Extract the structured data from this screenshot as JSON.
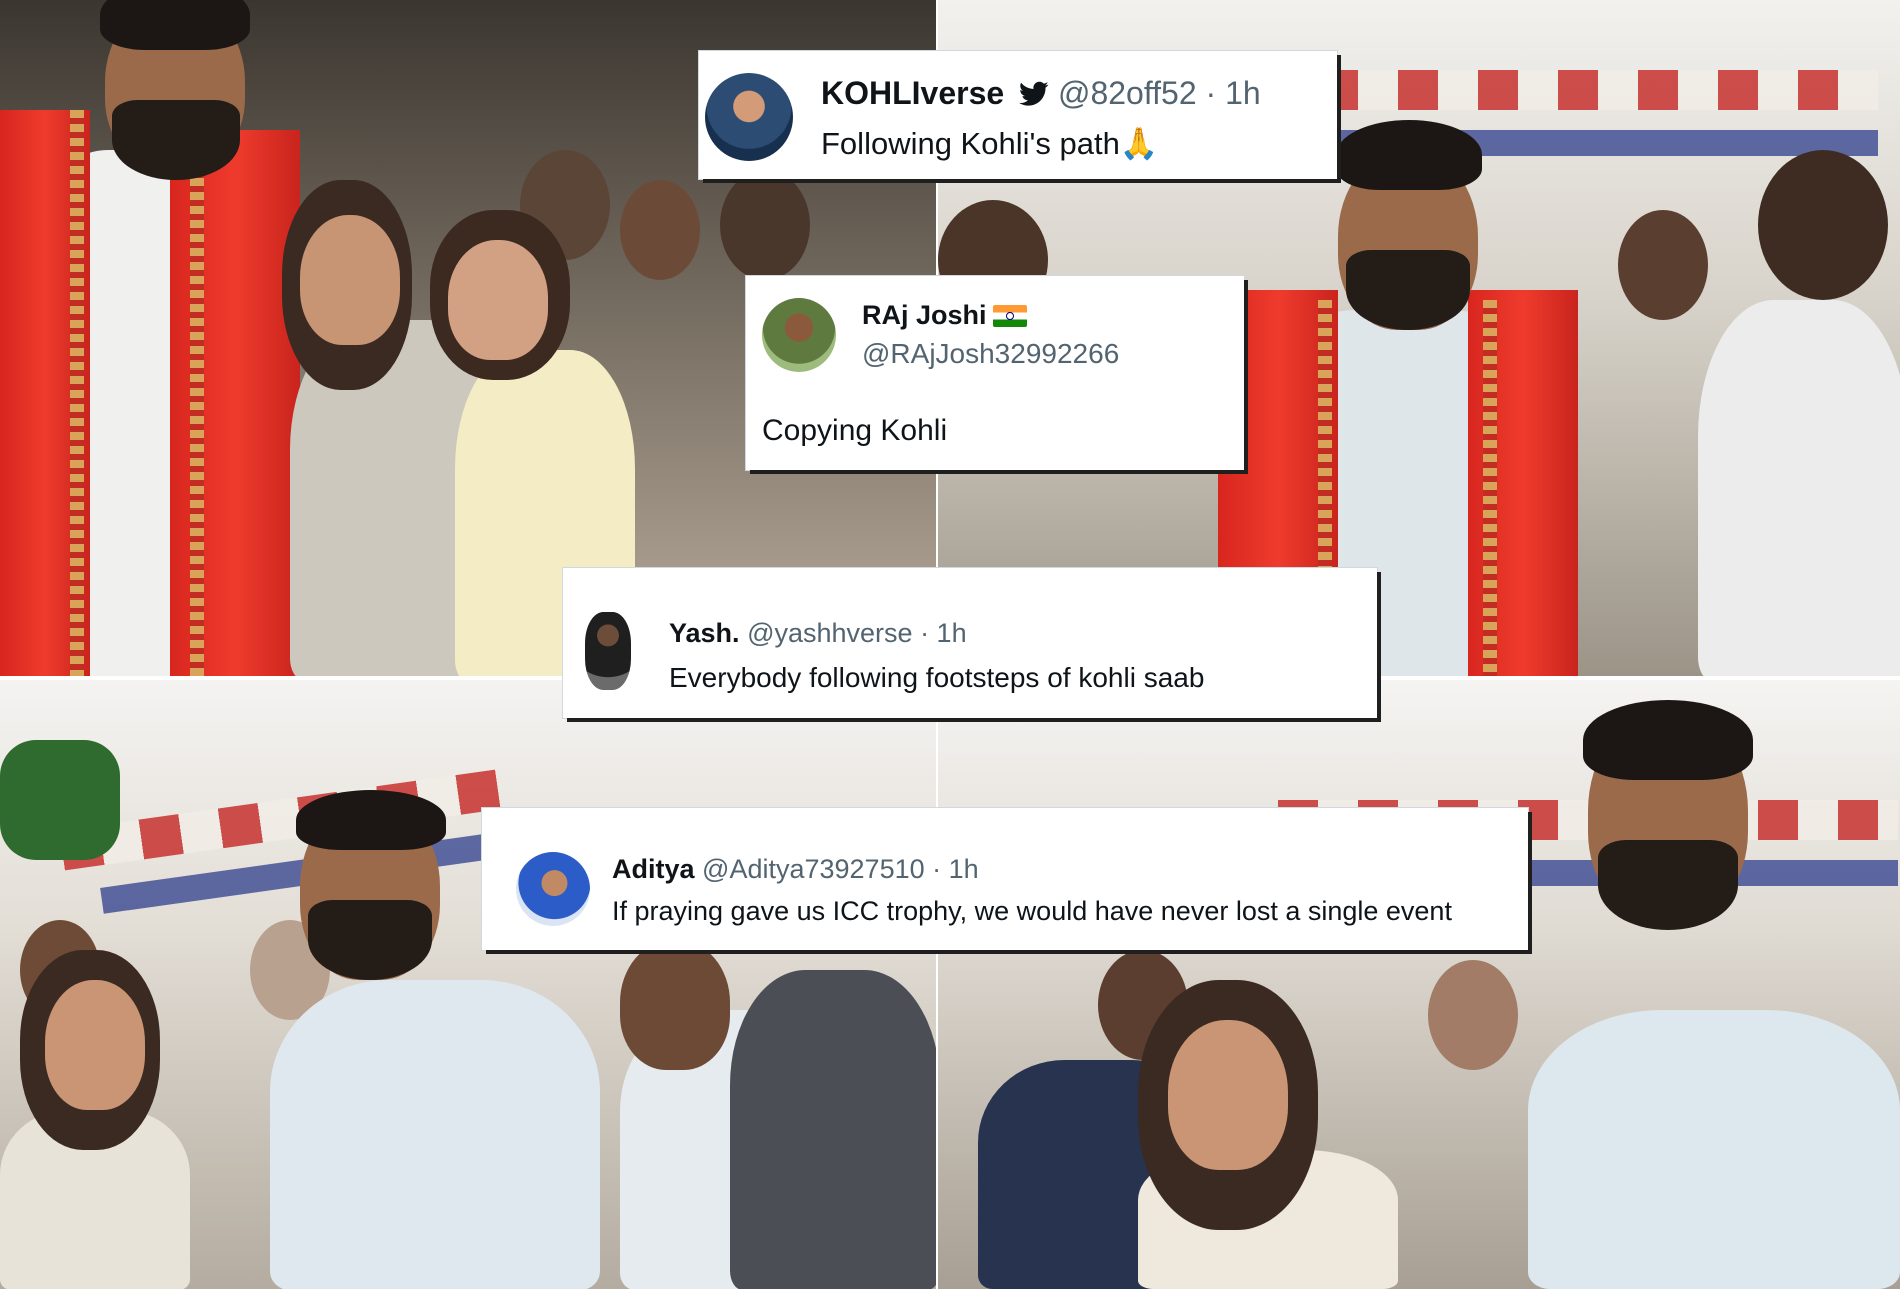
{
  "tweets": [
    {
      "name": "KOHLIverse",
      "handle": "@82off52",
      "time": "· 1h",
      "text": "Following Kohli's path",
      "emoji": "🙏",
      "bird_icon": "bird-icon"
    },
    {
      "name": "RAj Joshi",
      "flag_icon": "india-flag-icon",
      "handle": "@RAjJosh32992266",
      "text": "Copying Kohli"
    },
    {
      "name": "Yash.",
      "handle": "@yashhverse",
      "time": "· 1h",
      "text": "Everybody following footsteps of kohli saab"
    },
    {
      "name": "Aditya",
      "handle": "@Aditya73927510",
      "time": "· 1h",
      "text": "If praying gave us ICC trophy, we would have never lost a single event"
    }
  ],
  "colors": {
    "card_bg": "#ffffff",
    "name": "#0f1419",
    "handle": "#536471",
    "stole_red": "#e2302a"
  }
}
